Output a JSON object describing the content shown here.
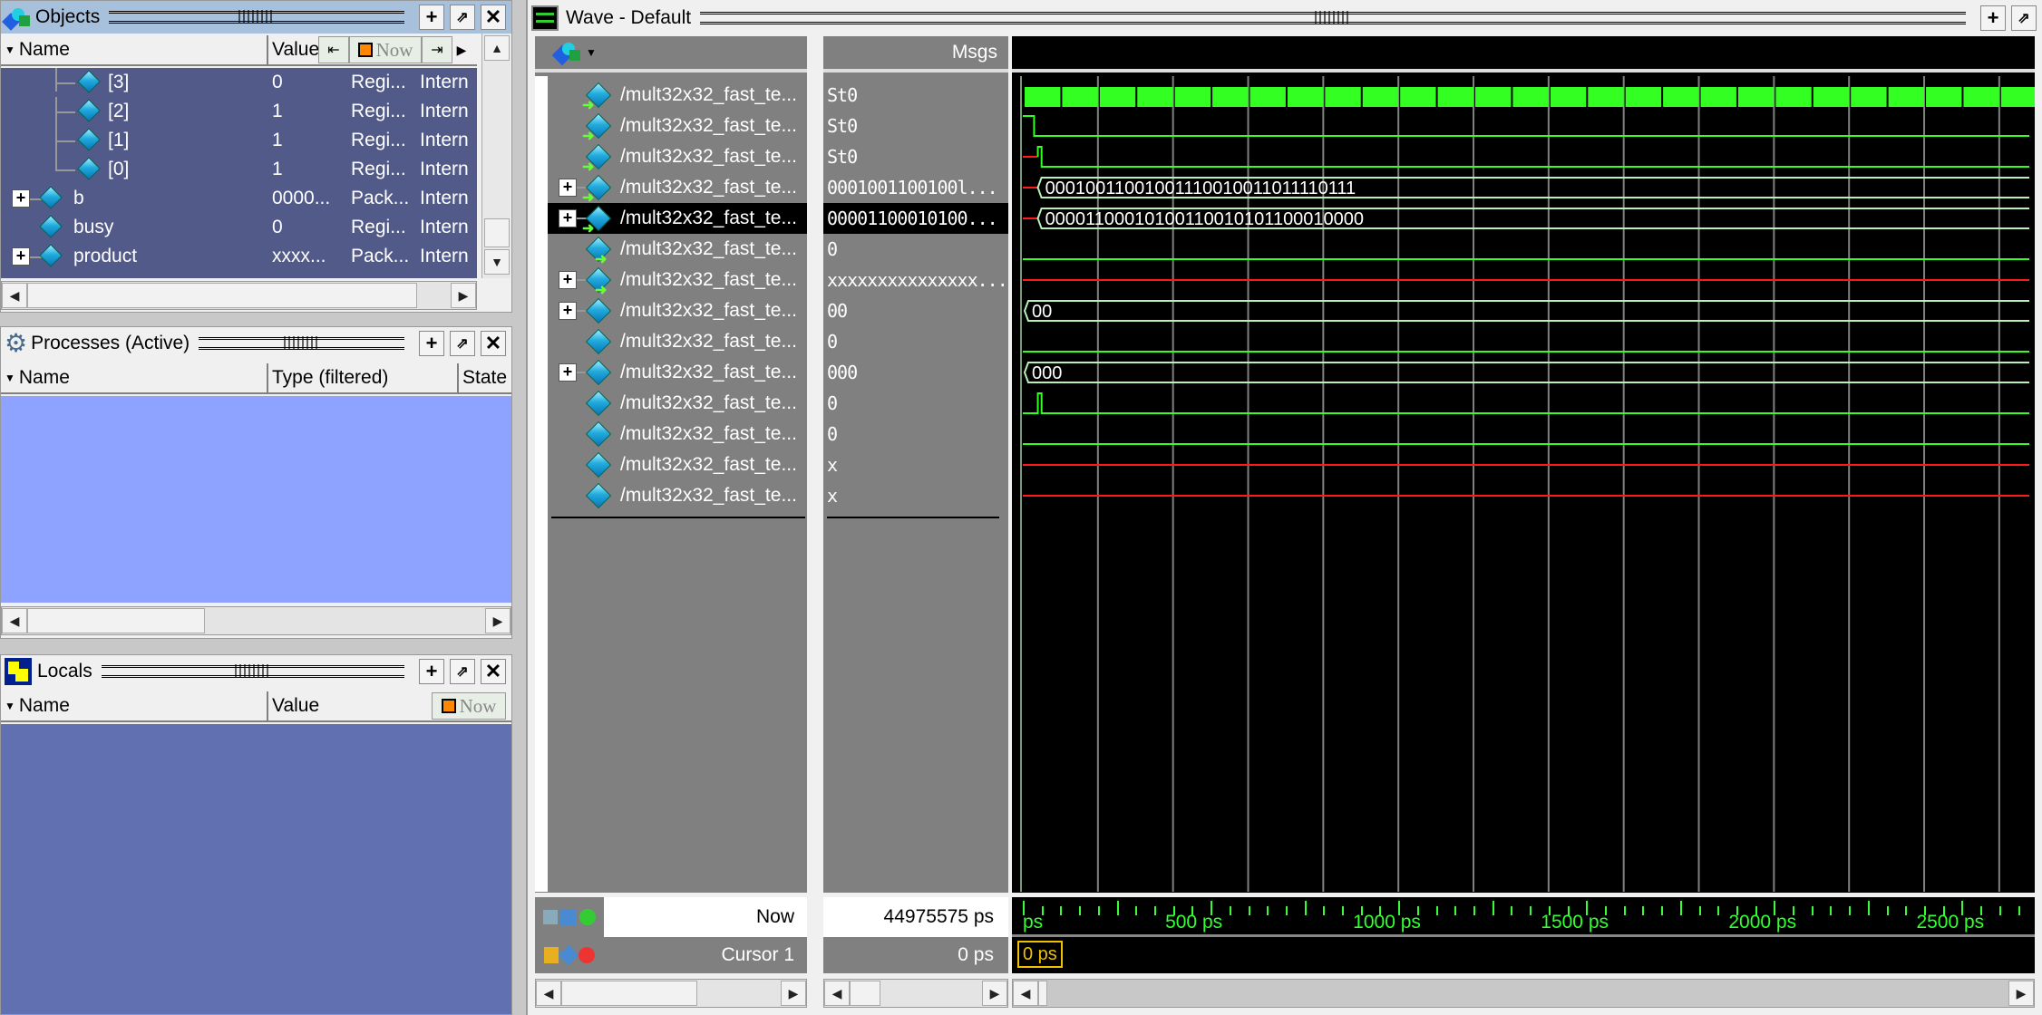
{
  "objects": {
    "title": "Objects",
    "columns": [
      "Name",
      "Value"
    ],
    "now_label": "Now",
    "rows": [
      {
        "name": "[3]",
        "value": "0",
        "kind": "Regi...",
        "mode": "Intern",
        "indent": 2,
        "expandable": false
      },
      {
        "name": "[2]",
        "value": "1",
        "kind": "Regi...",
        "mode": "Intern",
        "indent": 2,
        "expandable": false
      },
      {
        "name": "[1]",
        "value": "1",
        "kind": "Regi...",
        "mode": "Intern",
        "indent": 2,
        "expandable": false
      },
      {
        "name": "[0]",
        "value": "1",
        "kind": "Regi...",
        "mode": "Intern",
        "indent": 2,
        "expandable": false
      },
      {
        "name": "b",
        "value": "0000...",
        "kind": "Pack...",
        "mode": "Intern",
        "indent": 0,
        "expandable": true
      },
      {
        "name": "busy",
        "value": "0",
        "kind": "Regi...",
        "mode": "Intern",
        "indent": 0,
        "expandable": false
      },
      {
        "name": "product",
        "value": "xxxx...",
        "kind": "Pack...",
        "mode": "Intern",
        "indent": 0,
        "expandable": true
      }
    ]
  },
  "processes": {
    "title": "Processes (Active)",
    "columns": [
      "Name",
      "Type (filtered)",
      "State"
    ]
  },
  "locals": {
    "title": "Locals",
    "columns": [
      "Name",
      "Value"
    ],
    "now_label": "Now"
  },
  "wave": {
    "title": "Wave - Default",
    "msgs_label": "Msgs",
    "signals": [
      {
        "name": "/mult32x32_fast_te...",
        "value": "St0",
        "icon": "input",
        "expandable": false,
        "wave": "clock"
      },
      {
        "name": "/mult32x32_fast_te...",
        "value": "St0",
        "icon": "input",
        "expandable": false,
        "wave": "fall-early"
      },
      {
        "name": "/mult32x32_fast_te...",
        "value": "St0",
        "icon": "input",
        "expandable": false,
        "wave": "pulse-x"
      },
      {
        "name": "/mult32x32_fast_te...",
        "value": "0001001100100l...",
        "icon": "input",
        "expandable": true,
        "wave": "bus",
        "bus_text": "00010011001001110010011011110111"
      },
      {
        "name": "/mult32x32_fast_te...",
        "value": "00001100010100...",
        "icon": "input",
        "expandable": true,
        "wave": "bus",
        "bus_text": "00001100010100110010101100010000",
        "selected": true
      },
      {
        "name": "/mult32x32_fast_te...",
        "value": "0",
        "icon": "output",
        "expandable": false,
        "wave": "low"
      },
      {
        "name": "/mult32x32_fast_te...",
        "value": "xxxxxxxxxxxxxxx...",
        "icon": "output",
        "expandable": true,
        "wave": "x"
      },
      {
        "name": "/mult32x32_fast_te...",
        "value": "00",
        "icon": "internal",
        "expandable": true,
        "wave": "bus",
        "bus_text": "00"
      },
      {
        "name": "/mult32x32_fast_te...",
        "value": "0",
        "icon": "internal",
        "expandable": false,
        "wave": "low"
      },
      {
        "name": "/mult32x32_fast_te...",
        "value": "000",
        "icon": "internal",
        "expandable": true,
        "wave": "bus",
        "bus_text": "000"
      },
      {
        "name": "/mult32x32_fast_te...",
        "value": "0",
        "icon": "internal",
        "expandable": false,
        "wave": "pulse"
      },
      {
        "name": "/mult32x32_fast_te...",
        "value": "0",
        "icon": "internal",
        "expandable": false,
        "wave": "low"
      },
      {
        "name": "/mult32x32_fast_te...",
        "value": "x",
        "icon": "internal",
        "expandable": false,
        "wave": "x"
      },
      {
        "name": "/mult32x32_fast_te...",
        "value": "x",
        "icon": "internal",
        "expandable": false,
        "wave": "x"
      }
    ],
    "now_label": "Now",
    "now_value": "44975575 ps",
    "cursor_label": "Cursor 1",
    "cursor_value": "0 ps",
    "cursor_marker": "0 ps",
    "time_axis": {
      "labels": [
        "ps",
        "500 ps",
        "1000 ps",
        "1500 ps",
        "2000 ps",
        "2500 ps"
      ],
      "label_values_ps": [
        0,
        500,
        1000,
        1500,
        2000,
        2500
      ],
      "max_ps": 2680,
      "grid_step_ps": 200,
      "clock_period_ps": 100
    },
    "colors": {
      "high": "#33ff22",
      "x": "#ff1a1a",
      "bus": "#b8f0b8",
      "grid": "#808080",
      "cursor": "#f0c000"
    }
  }
}
